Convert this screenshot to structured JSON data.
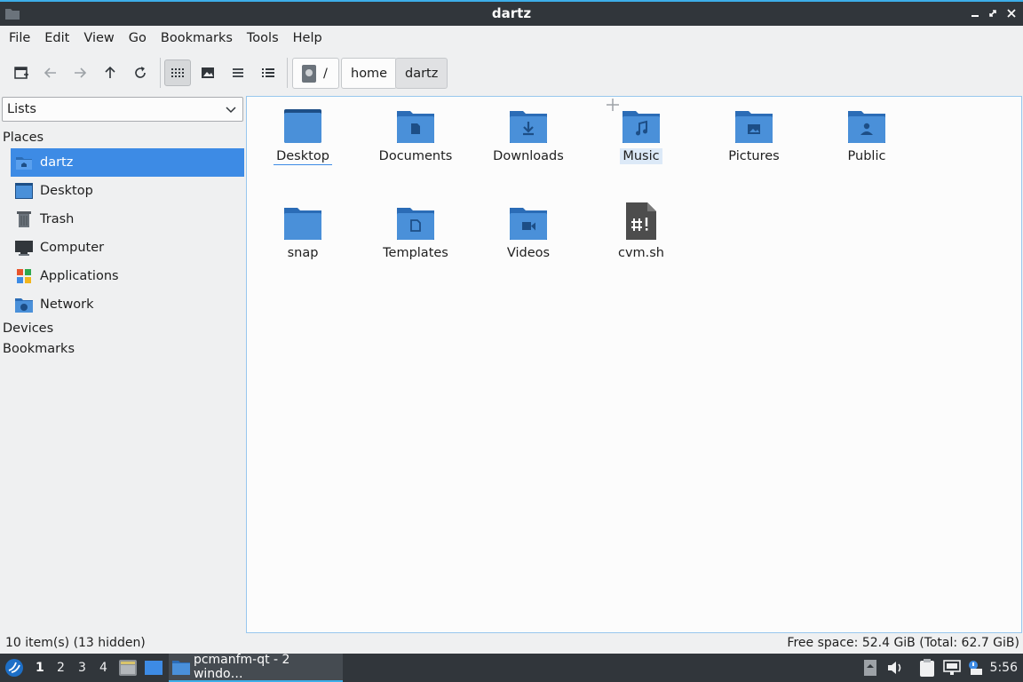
{
  "window": {
    "title": "dartz"
  },
  "menu": [
    "File",
    "Edit",
    "View",
    "Go",
    "Bookmarks",
    "Tools",
    "Help"
  ],
  "breadcrumbs": {
    "root": "/",
    "items": [
      "home",
      "dartz"
    ]
  },
  "side": {
    "selector": "Lists",
    "places_header": "Places",
    "places": [
      {
        "label": "dartz",
        "icon": "home-folder-icon",
        "selected": true
      },
      {
        "label": "Desktop",
        "icon": "desktop-icon"
      },
      {
        "label": "Trash",
        "icon": "trash-icon"
      },
      {
        "label": "Computer",
        "icon": "computer-icon"
      },
      {
        "label": "Applications",
        "icon": "applications-icon"
      },
      {
        "label": "Network",
        "icon": "network-icon"
      }
    ],
    "devices_header": "Devices",
    "bookmarks_header": "Bookmarks"
  },
  "files": [
    {
      "name": "Desktop",
      "icon": "folder-desktop-icon"
    },
    {
      "name": "Documents",
      "icon": "folder-documents-icon"
    },
    {
      "name": "Downloads",
      "icon": "folder-downloads-icon"
    },
    {
      "name": "Music",
      "icon": "folder-music-icon"
    },
    {
      "name": "Pictures",
      "icon": "folder-pictures-icon"
    },
    {
      "name": "Public",
      "icon": "folder-public-icon"
    },
    {
      "name": "snap",
      "icon": "folder-icon"
    },
    {
      "name": "Templates",
      "icon": "folder-templates-icon"
    },
    {
      "name": "Videos",
      "icon": "folder-videos-icon"
    },
    {
      "name": "cvm.sh",
      "icon": "shell-script-icon"
    }
  ],
  "status": {
    "left": "10 item(s) (13 hidden)",
    "right": "Free space: 52.4 GiB (Total: 62.7 GiB)"
  },
  "taskbar": {
    "workspaces": [
      "1",
      "2",
      "3",
      "4"
    ],
    "task_label": "pcmanfm-qt - 2 windo…",
    "clock": "5:56"
  },
  "colors": {
    "accent": "#3d8be5",
    "folder": "#4a90d9",
    "titlebar": "#31363b"
  }
}
